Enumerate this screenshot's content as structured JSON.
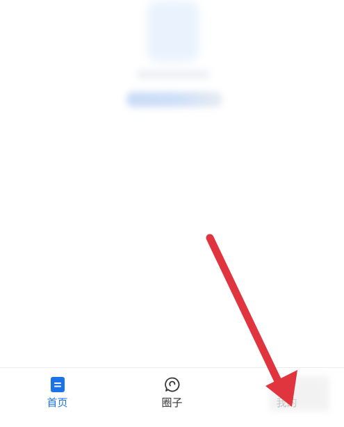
{
  "tabbar": {
    "tabs": [
      {
        "label": "首页",
        "icon": "home-doc-icon",
        "active": true
      },
      {
        "label": "圈子",
        "icon": "circle-chat-icon",
        "active": false
      },
      {
        "label": "我的",
        "icon": "profile-icon",
        "active": false
      }
    ]
  },
  "colors": {
    "accent": "#1a73e8",
    "annotation_arrow": "#e0353f",
    "inactive_text": "#333333"
  }
}
